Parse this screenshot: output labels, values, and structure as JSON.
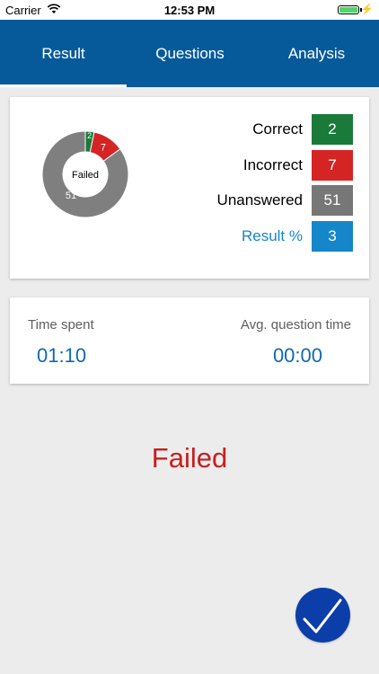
{
  "status_bar": {
    "carrier": "Carrier",
    "time": "12:53 PM",
    "wifi_icon": "wifi-icon",
    "battery_icon": "battery-icon",
    "charging_icon": "charging-bolt-icon"
  },
  "tabs": [
    {
      "label": "Result",
      "selected": true
    },
    {
      "label": "Questions",
      "selected": false
    },
    {
      "label": "Analysis",
      "selected": false
    }
  ],
  "summary": {
    "donut": {
      "center_label": "Failed",
      "segments": [
        {
          "label": "2",
          "value": 2,
          "color": "#1a7a3a"
        },
        {
          "label": "7",
          "value": 7,
          "color": "#d42424"
        },
        {
          "label": "51",
          "value": 51,
          "color": "#7f7f7f"
        }
      ]
    },
    "stats": [
      {
        "label": "Correct",
        "value": "2",
        "color": "#1a7a3a",
        "label_color": "#000000"
      },
      {
        "label": "Incorrect",
        "value": "7",
        "color": "#d42424",
        "label_color": "#000000"
      },
      {
        "label": "Unanswered",
        "value": "51",
        "color": "#777777",
        "label_color": "#000000"
      },
      {
        "label": "Result %",
        "value": "3",
        "color": "#1486c9",
        "label_color": "#1486c9"
      }
    ]
  },
  "timing": {
    "time_spent_label": "Time spent",
    "time_spent_value": "01:10",
    "avg_label": "Avg. question time",
    "avg_value": "00:00"
  },
  "result_status": "Failed",
  "done_button_icon": "checkmark-icon",
  "colors": {
    "primary": "#075a9a",
    "failed": "#c81e1e",
    "button": "#0b3ea8"
  }
}
